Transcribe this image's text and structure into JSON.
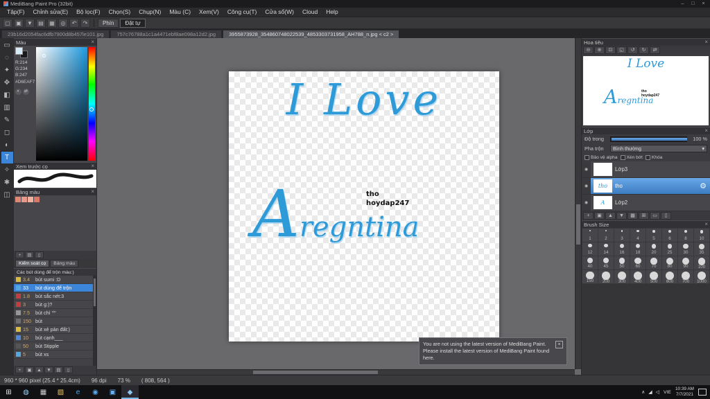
{
  "window": {
    "title": "MediBang Paint Pro (32bit)",
    "controls": {
      "minimize": "–",
      "maximize": "□",
      "close": "×"
    }
  },
  "icons": {
    "close": "×",
    "dropdown": "▾",
    "eye": "◉",
    "gear": "⚙"
  },
  "menubar": {
    "items": [
      "Tập(F)",
      "Chỉnh sửa(E)",
      "Bộ lọc(F)",
      "Chọn(S)",
      "Chụp(N)",
      "Màu (C)",
      "Xem(V)",
      "Công cụ(T)",
      "Cửa sổ(W)",
      "Cloud",
      "Help"
    ]
  },
  "toolbar": {
    "icons": [
      {
        "name": "new-file-icon",
        "glyph": "▢"
      },
      {
        "name": "open-file-icon",
        "glyph": "▣"
      },
      {
        "name": "save-icon",
        "glyph": "▼"
      },
      {
        "name": "export-icon",
        "glyph": "▤"
      },
      {
        "name": "grid-icon",
        "glyph": "▦"
      },
      {
        "name": "symmetry-icon",
        "glyph": "◎"
      },
      {
        "name": "undo-icon",
        "glyph": "↶"
      },
      {
        "name": "redo-icon",
        "glyph": "↷"
      }
    ],
    "buttons": [
      {
        "label": "Phín"
      },
      {
        "label": "Đặt tự",
        "selected": true
      }
    ]
  },
  "tabbar": {
    "tabs": [
      {
        "label": "23b16d2054fac6dfb7900d8b457le101.jpg"
      },
      {
        "label": "757c76788a1c1a4471ebf8ae098a12d2.jpg"
      },
      {
        "label": "3955873928_354860748022539_4853303731958_AH788_n.jpg < c2 >",
        "selected": true
      }
    ]
  },
  "tools": [
    {
      "name": "select-tool",
      "glyph": "▭"
    },
    {
      "name": "lasso-tool",
      "glyph": "◌"
    },
    {
      "name": "magic-wand-tool",
      "glyph": "✦"
    },
    {
      "name": "move-tool",
      "glyph": "✥"
    },
    {
      "name": "fill-tool",
      "glyph": "◧"
    },
    {
      "name": "gradient-tool",
      "glyph": "▥"
    },
    {
      "name": "brush-tool",
      "glyph": "✎"
    },
    {
      "name": "eraser-tool",
      "glyph": "◻"
    },
    {
      "name": "blur-tool",
      "glyph": "◐"
    },
    {
      "name": "text-tool",
      "glyph": "T",
      "selected": true
    },
    {
      "name": "eyedropper-tool",
      "glyph": "✧"
    },
    {
      "name": "hand-tool",
      "glyph": "✱"
    },
    {
      "name": "divide-tool",
      "glyph": "◫"
    }
  ],
  "color_panel": {
    "title": "Màu",
    "r": "R:214",
    "g": "G:234",
    "b": "B:247",
    "hex": "#D6EAF7",
    "current_color": "#d6eaf7",
    "current_color_style": "background:#d6eaf7"
  },
  "brush_preview_panel": {
    "title": "Xem trước cọ"
  },
  "palette_panel": {
    "title": "Bảng màu",
    "swatches": [
      {
        "chip": "#e08878"
      },
      {
        "chip": "#e89a8a"
      },
      {
        "chip": "#f0b0a0"
      },
      {
        "chip": "#d87868"
      }
    ],
    "tools": [
      {
        "name": "add-color-icon",
        "glyph": "+"
      },
      {
        "name": "edit-color-icon",
        "glyph": "▤"
      },
      {
        "name": "delete-color-icon",
        "glyph": "▯"
      }
    ]
  },
  "left_tabs": [
    {
      "label": "Kiểm soát cọ",
      "selected": true
    },
    {
      "label": "Bảng màu"
    }
  ],
  "brush_panel": {
    "group_title": "Các bút dùng để trộn màu:)",
    "items": [
      {
        "size": "3.4",
        "name": "bút sumi :D",
        "chip": "#d9bb3d"
      },
      {
        "size": "33",
        "name": "bút dùng để trộn",
        "chip": "#56a7e0",
        "selected": true
      },
      {
        "size": "1.8",
        "name": "bút sắc nét:3",
        "chip": "#c04040"
      },
      {
        "size": "3",
        "name": "bút g:)?",
        "chip": "#c04040"
      },
      {
        "size": "7.5",
        "name": "bút chì '^'",
        "chip": "#979797"
      },
      {
        "size": "150",
        "name": "bút",
        "chip": "#6e6e6e"
      },
      {
        "size": "15",
        "name": "bút xẻ pản đất:)",
        "chip": "#d9bb3d"
      },
      {
        "size": "10",
        "name": "bút cạnh___",
        "chip": "#4f86d6"
      },
      {
        "size": "50",
        "name": "bút Stipple",
        "chip": "#555555"
      },
      {
        "size": "5",
        "name": "bút xs",
        "chip": "#56a7e0"
      }
    ],
    "tools": [
      {
        "name": "add-brush-icon",
        "glyph": "+"
      },
      {
        "name": "brush-folder-icon",
        "glyph": "▣"
      },
      {
        "name": "brush-up-icon",
        "glyph": "▲"
      },
      {
        "name": "brush-down-icon",
        "glyph": "▼"
      },
      {
        "name": "brush-settings-icon",
        "glyph": "▤"
      },
      {
        "name": "delete-brush-icon",
        "glyph": "▯"
      }
    ]
  },
  "canvas": {
    "art_line1": "I Love",
    "art_line2_initial": "A",
    "art_line2_rest": "regntina",
    "watermark_line1": "tho",
    "watermark_line2": "hoydap247"
  },
  "notification": {
    "line1": "You are not using the latest version of MediBang Paint.",
    "line2": "Please install the latest version of MediBang Paint found here.",
    "close": "×"
  },
  "navigator": {
    "title": "Hoa tiêu",
    "tools": [
      {
        "name": "zoom-out-icon",
        "glyph": "⊖"
      },
      {
        "name": "zoom-in-icon",
        "glyph": "⊕"
      },
      {
        "name": "zoom-reset-icon",
        "glyph": "⊡"
      },
      {
        "name": "fit-window-icon",
        "glyph": "◱"
      },
      {
        "name": "rotate-left-icon",
        "glyph": "↺"
      },
      {
        "name": "rotate-right-icon",
        "glyph": "↻"
      },
      {
        "name": "reset-rotation-icon",
        "glyph": "⇄"
      }
    ]
  },
  "layers_panel": {
    "title": "Lớp",
    "opacity_label": "Độ trong",
    "opacity_value": "100 %",
    "blend_label": "Pha trộn",
    "blend_value": "Bình thường",
    "checkboxes": [
      {
        "label": "Bảo vệ alpha"
      },
      {
        "label": "Xén bớt"
      },
      {
        "label": "Khóa"
      }
    ],
    "layers": [
      {
        "name": "Lớp3",
        "thumb": ""
      },
      {
        "name": "tho",
        "thumb": "tho",
        "selected": true
      },
      {
        "name": "Lớp2",
        "thumb": "A"
      }
    ],
    "tools": [
      {
        "name": "add-layer-icon",
        "glyph": "+"
      },
      {
        "name": "layer-folder-icon",
        "glyph": "▣"
      },
      {
        "name": "layer-up-icon",
        "glyph": "▲"
      },
      {
        "name": "layer-down-icon",
        "glyph": "▼"
      },
      {
        "name": "duplicate-layer-icon",
        "glyph": "▩"
      },
      {
        "name": "merge-layer-icon",
        "glyph": "⊞"
      },
      {
        "name": "clear-layer-icon",
        "glyph": "▭"
      },
      {
        "name": "delete-layer-icon",
        "glyph": "▯"
      }
    ]
  },
  "brush_size_panel": {
    "title": "Brush Size",
    "sizes": [
      1,
      2,
      3,
      4,
      5,
      6,
      8,
      10,
      12,
      14,
      16,
      18,
      20,
      25,
      30,
      35,
      40,
      45,
      50,
      60,
      70,
      80,
      90,
      100,
      150,
      200,
      300,
      400,
      500,
      600,
      700,
      1000
    ]
  },
  "statusbar": {
    "size_info": "960 * 960 pixel (25.4 * 25.4cm)",
    "dpi": "96 dpi",
    "zoom": "73 %",
    "coords": "( 808, 564 )"
  },
  "taskbar": {
    "apps": [
      {
        "name": "start-button",
        "glyph": "⊞",
        "chip": "#e8e8e8"
      },
      {
        "name": "cortana-icon",
        "glyph": "◍",
        "chip": "#9ad0f0"
      },
      {
        "name": "task-view-icon",
        "glyph": "▦",
        "chip": "#cccccc"
      },
      {
        "name": "file-explorer-icon",
        "glyph": "▨",
        "chip": "#e8c35a"
      },
      {
        "name": "edge-icon",
        "glyph": "e",
        "chip": "#4fa3e3"
      },
      {
        "name": "chrome-icon",
        "glyph": "◉",
        "chip": "#5aa7e8"
      },
      {
        "name": "photos-icon",
        "glyph": "▣",
        "chip": "#6ab0f0"
      },
      {
        "name": "medibang-app-icon",
        "glyph": "◆",
        "chip": "#8ac5f0",
        "selected": true
      }
    ],
    "tray_icons": [
      {
        "name": "tray-expand-icon",
        "glyph": "∧"
      },
      {
        "name": "network-icon",
        "glyph": "◢"
      },
      {
        "name": "volume-icon",
        "glyph": "◁"
      }
    ],
    "language": "VIE",
    "time": "10:39 AM",
    "date": "7/7/2021"
  }
}
